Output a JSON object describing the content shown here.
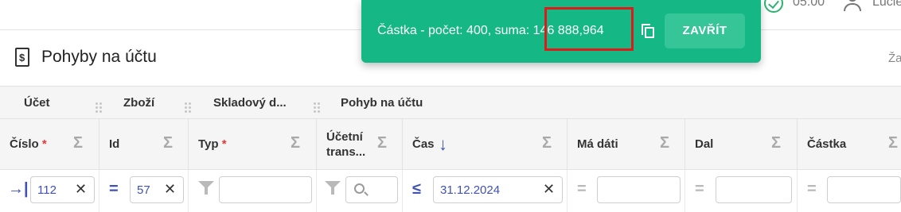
{
  "topbar": {
    "time": "05:00",
    "user": "Lucie"
  },
  "page": {
    "title": "Pohyby na účtu",
    "right_cut": "Ža"
  },
  "groups": [
    "Účet",
    "Zboží",
    "Skladový d...",
    "Pohyb na účtu"
  ],
  "columns": [
    {
      "line1": "Číslo",
      "required": true
    },
    {
      "line1": "Id",
      "required": false
    },
    {
      "line1": "Typ",
      "required": true
    },
    {
      "line1": "Účetní",
      "line2": "trans..."
    },
    {
      "line1": "Čas",
      "sorted": "desc"
    },
    {
      "line1": "Má dáti"
    },
    {
      "line1": "Dal"
    },
    {
      "line1": "Částka"
    }
  ],
  "filters": {
    "cislo": {
      "op": "→|",
      "value": "112"
    },
    "id": {
      "op": "=",
      "value": "57"
    },
    "cas": {
      "op": "≤",
      "value": "31.12.2024"
    },
    "madati": {
      "op": "="
    },
    "dal": {
      "op": "="
    },
    "castka": {
      "op": "="
    }
  },
  "icons": {
    "sigma": "Σ",
    "clear": "✕",
    "sort_desc": "↓"
  },
  "toast": {
    "message": "Částka - počet: 400, suma:",
    "sum": "146 888,964",
    "close_label": "ZAVŘÍT"
  },
  "colors": {
    "accent": "#3f51b5",
    "toast": "#15b784",
    "required": "#e53935",
    "highlight": "#e01919"
  }
}
